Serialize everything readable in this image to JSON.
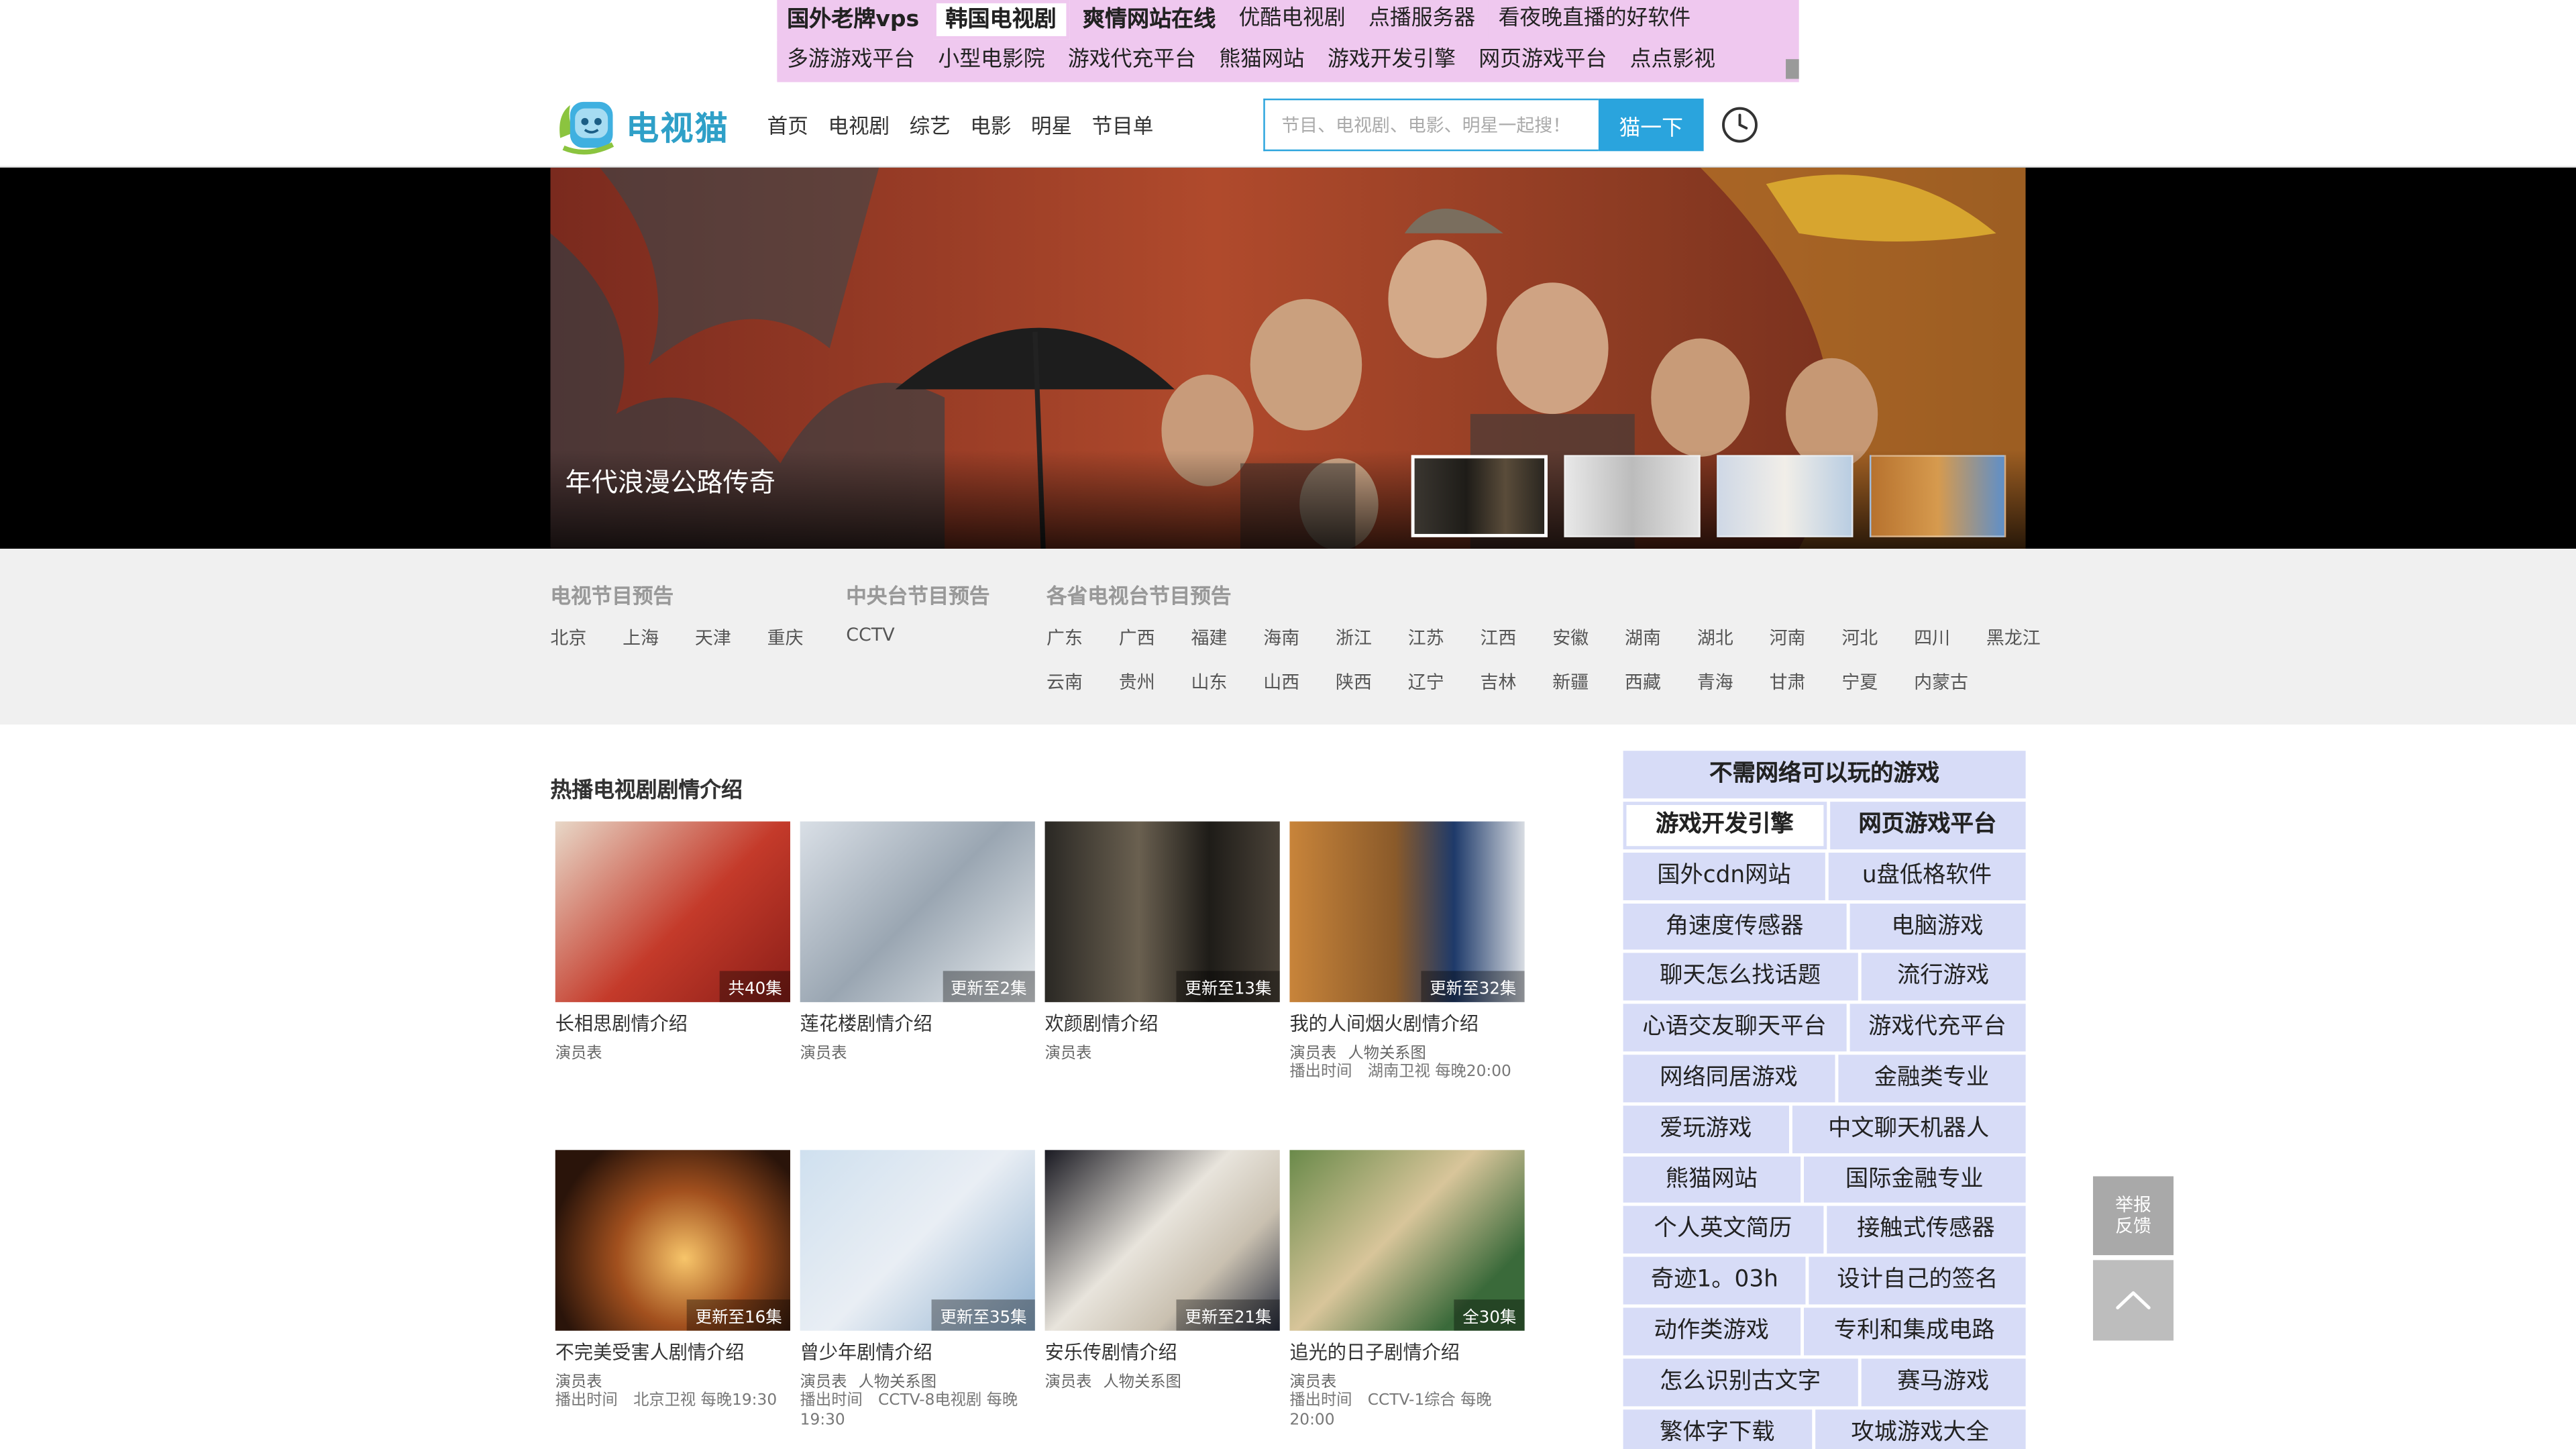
{
  "ads": {
    "row1": [
      {
        "label": "国外老牌vps",
        "style": "bold"
      },
      {
        "label": "韩国电视剧",
        "style": "boxed bold"
      },
      {
        "label": "爽情网站在线",
        "style": "bold"
      },
      {
        "label": "优酷电视剧",
        "style": ""
      },
      {
        "label": "点播服务器",
        "style": ""
      },
      {
        "label": "看夜晚直播的好软件",
        "style": ""
      }
    ],
    "row2": [
      {
        "label": "多游游戏平台",
        "style": ""
      },
      {
        "label": "小型电影院",
        "style": ""
      },
      {
        "label": "游戏代充平台",
        "style": ""
      },
      {
        "label": "熊猫网站",
        "style": ""
      },
      {
        "label": "游戏开发引擎",
        "style": ""
      },
      {
        "label": "网页游戏平台",
        "style": ""
      },
      {
        "label": "点点影视",
        "style": ""
      }
    ]
  },
  "header": {
    "logo_text": "电视猫",
    "nav": [
      "首页",
      "电视剧",
      "综艺",
      "电影",
      "明星",
      "节目单"
    ],
    "search_placeholder": "节目、电视剧、电影、明星一起搜！",
    "search_button": "猫一下"
  },
  "banner": {
    "title": "年代浪漫公路传奇"
  },
  "schedule": {
    "tv": {
      "title": "电视节目预告",
      "items": [
        "北京",
        "上海",
        "天津",
        "重庆"
      ]
    },
    "cctv": {
      "title": "中央台节目预告",
      "items": [
        "CCTV"
      ]
    },
    "provincial": {
      "title": "各省电视台节目预告",
      "row1": [
        "广东",
        "广西",
        "福建",
        "海南",
        "浙江",
        "江苏",
        "江西",
        "安徽",
        "湖南",
        "湖北",
        "河南",
        "河北",
        "四川",
        "黑龙江"
      ],
      "row2": [
        "云南",
        "贵州",
        "山东",
        "山西",
        "陕西",
        "辽宁",
        "吉林",
        "新疆",
        "西藏",
        "青海",
        "甘肃",
        "宁夏",
        "内蒙古"
      ]
    }
  },
  "hot": {
    "title": "热播电视剧剧情介绍",
    "cards": [
      {
        "title": "长相思剧情介绍",
        "ep": "共40集",
        "links": [
          "演员表"
        ],
        "air": ""
      },
      {
        "title": "莲花楼剧情介绍",
        "ep": "更新至2集",
        "links": [
          "演员表"
        ],
        "air": ""
      },
      {
        "title": "欢颜剧情介绍",
        "ep": "更新至13集",
        "links": [
          "演员表"
        ],
        "air": ""
      },
      {
        "title": "我的人间烟火剧情介绍",
        "ep": "更新至32集",
        "links": [
          "演员表",
          "人物关系图"
        ],
        "air": "播出时间　湖南卫视 每晚20:00"
      },
      {
        "title": "不完美受害人剧情介绍",
        "ep": "更新至16集",
        "links": [
          "演员表"
        ],
        "air": "播出时间　北京卫视 每晚19:30"
      },
      {
        "title": "曾少年剧情介绍",
        "ep": "更新至35集",
        "links": [
          "演员表",
          "人物关系图"
        ],
        "air": "播出时间　CCTV-8电视剧 每晚19:30"
      },
      {
        "title": "安乐传剧情介绍",
        "ep": "更新至21集",
        "links": [
          "演员表",
          "人物关系图"
        ],
        "air": ""
      },
      {
        "title": "追光的日子剧情介绍",
        "ep": "全30集",
        "links": [
          "演员表"
        ],
        "air": "播出时间　CCTV-1综合 每晚20:00"
      }
    ]
  },
  "side": {
    "title": "不需网络可以玩的游戏",
    "rows": [
      [
        {
          "label": "游戏开发引擎",
          "style": "boxed"
        },
        {
          "label": "网页游戏平台",
          "style": "bold"
        }
      ],
      [
        {
          "label": "国外cdn网站",
          "style": ""
        },
        {
          "label": "u盘低格软件",
          "style": ""
        }
      ],
      [
        {
          "label": "角速度传感器",
          "style": ""
        },
        {
          "label": "电脑游戏",
          "style": ""
        }
      ],
      [
        {
          "label": "聊天怎么找话题",
          "style": ""
        },
        {
          "label": "流行游戏",
          "style": ""
        }
      ],
      [
        {
          "label": "心语交友聊天平台",
          "style": ""
        },
        {
          "label": "游戏代充平台",
          "style": ""
        }
      ],
      [
        {
          "label": "网络同居游戏",
          "style": ""
        },
        {
          "label": "金融类专业",
          "style": ""
        }
      ],
      [
        {
          "label": "爱玩游戏",
          "style": ""
        },
        {
          "label": "中文聊天机器人",
          "style": ""
        }
      ],
      [
        {
          "label": "熊猫网站",
          "style": ""
        },
        {
          "label": "国际金融专业",
          "style": ""
        }
      ],
      [
        {
          "label": "个人英文简历",
          "style": ""
        },
        {
          "label": "接触式传感器",
          "style": ""
        }
      ],
      [
        {
          "label": "奇迹1。03h",
          "style": ""
        },
        {
          "label": "设计自己的签名",
          "style": ""
        }
      ],
      [
        {
          "label": "动作类游戏",
          "style": ""
        },
        {
          "label": "专利和集成电路",
          "style": ""
        }
      ],
      [
        {
          "label": "怎么识别古文字",
          "style": ""
        },
        {
          "label": "赛马游戏",
          "style": ""
        }
      ],
      [
        {
          "label": "繁体字下载",
          "style": ""
        },
        {
          "label": "攻城游戏大全",
          "style": ""
        }
      ]
    ]
  },
  "floating": {
    "report": "举报\n反馈"
  },
  "colors": {
    "accent": "#2aa4dd",
    "ad_bg": "#efc8ef",
    "side_bg": "#d7dcf7",
    "schedule_bg": "#f0f0f0"
  },
  "icons": {
    "history": "clock-icon",
    "back_top": "chevron-up-icon"
  }
}
